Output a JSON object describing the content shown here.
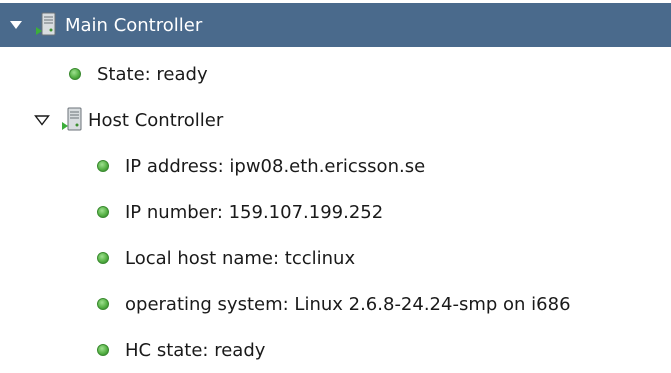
{
  "tree": {
    "root": {
      "label": "Main Controller",
      "expanded": true,
      "selected": true,
      "icon": "server-icon",
      "children": [
        {
          "label": "State: ready",
          "icon": "green-status-dot"
        }
      ]
    },
    "host": {
      "label": "Host Controller",
      "expanded": true,
      "icon": "server-icon",
      "children": [
        {
          "label": "IP address: ipw08.eth.ericsson.se",
          "icon": "green-status-dot"
        },
        {
          "label": "IP number: 159.107.199.252",
          "icon": "green-status-dot"
        },
        {
          "label": "Local host name: tcclinux",
          "icon": "green-status-dot"
        },
        {
          "label": "operating system: Linux 2.6.8-24.24-smp on i686",
          "icon": "green-status-dot"
        },
        {
          "label": "HC state: ready",
          "icon": "green-status-dot"
        }
      ]
    }
  },
  "colors": {
    "selection": "#4a6a8c",
    "status_green": "#57b246"
  }
}
